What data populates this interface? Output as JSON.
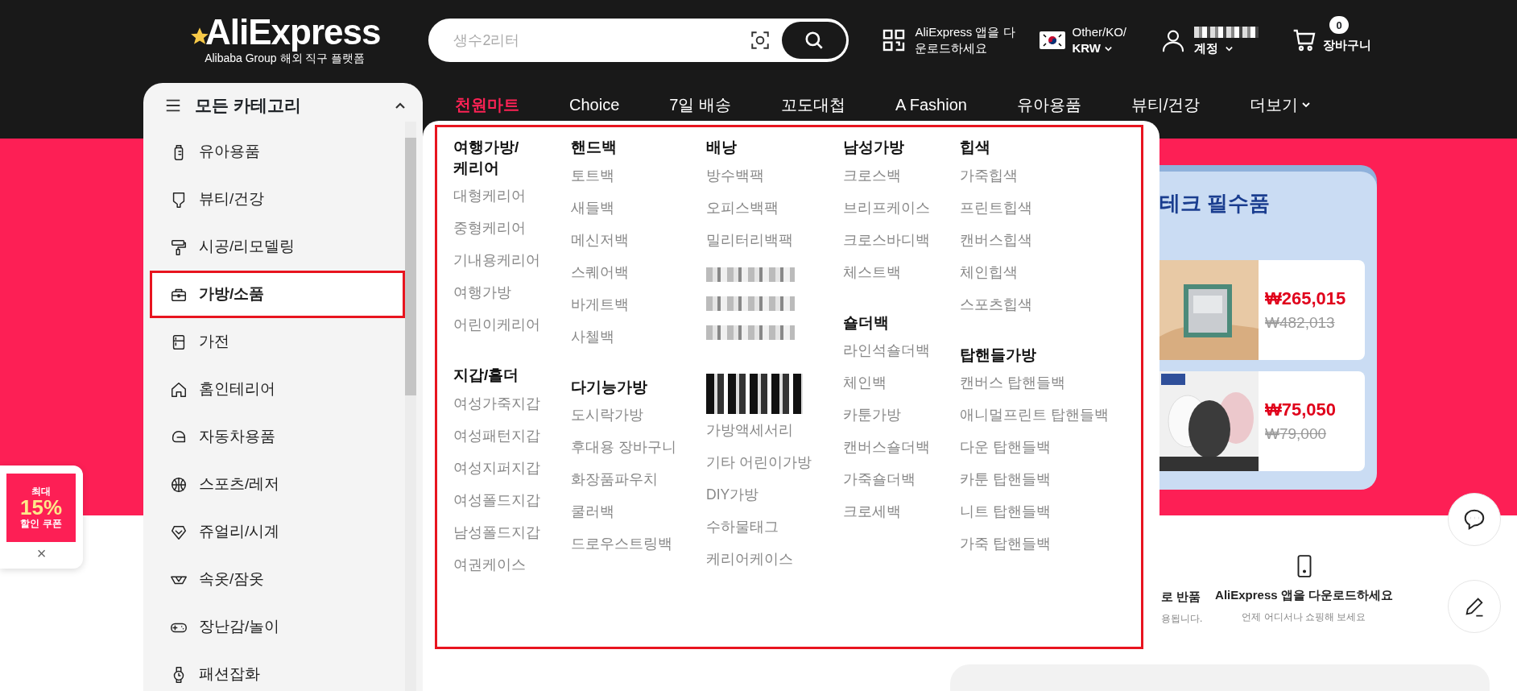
{
  "header": {
    "logo": "AliExpress",
    "tagline": "Alibaba Group 해외 직구 플랫폼",
    "search": {
      "placeholder": "생수2리터"
    },
    "app_download": "AliExpress 앱을 다운로드하세요",
    "region": {
      "line_1": "Other/KO/",
      "line_2": "KRW"
    },
    "account": {
      "name_redacted": true,
      "label": "계정"
    },
    "cart": {
      "count": "0",
      "label": "장바구니"
    }
  },
  "nav": [
    {
      "label": "천원마트",
      "highlight": true
    },
    {
      "label": "Choice",
      "highlight": false
    },
    {
      "label": "7일 배송",
      "highlight": false
    },
    {
      "label": "꼬도대첩",
      "highlight": false
    },
    {
      "label": "A Fashion",
      "highlight": false
    },
    {
      "label": "유아용품",
      "highlight": false
    },
    {
      "label": "뷰티/건강",
      "highlight": false
    },
    {
      "label": "더보기",
      "highlight": false,
      "dropdown": true
    }
  ],
  "sidebar": {
    "title": "모든 카테고리",
    "expanded": true,
    "items": [
      {
        "label": "유아용품",
        "selected": false
      },
      {
        "label": "뷰티/건강",
        "selected": false
      },
      {
        "label": "시공/리모델링",
        "selected": false
      },
      {
        "label": "가방/소품",
        "selected": true
      },
      {
        "label": "가전",
        "selected": false
      },
      {
        "label": "홈인테리어",
        "selected": false
      },
      {
        "label": "자동차용품",
        "selected": false
      },
      {
        "label": "스포츠/레저",
        "selected": false
      },
      {
        "label": "쥬얼리/시계",
        "selected": false
      },
      {
        "label": "속옷/잠옷",
        "selected": false
      },
      {
        "label": "장난감/놀이",
        "selected": false
      },
      {
        "label": "패션잡화",
        "selected": false
      }
    ]
  },
  "mega_menu": {
    "columns": [
      {
        "groups": [
          {
            "heading": {
              "kind": "title",
              "text": "여행가방/케리어"
            },
            "items": [
              {
                "kind": "link",
                "text": "대형케리어"
              },
              {
                "kind": "link",
                "text": "중형케리어"
              },
              {
                "kind": "link",
                "text": "기내용케리어"
              },
              {
                "kind": "link",
                "text": "여행가방"
              },
              {
                "kind": "link",
                "text": "어린이케리어"
              }
            ]
          },
          {
            "heading": {
              "kind": "title",
              "text": "지갑/홀더"
            },
            "items": [
              {
                "kind": "link",
                "text": "여성가죽지갑"
              },
              {
                "kind": "link",
                "text": "여성패턴지갑"
              },
              {
                "kind": "link",
                "text": "여성지퍼지갑"
              },
              {
                "kind": "link",
                "text": "여성폴드지갑"
              },
              {
                "kind": "link",
                "text": "남성폴드지갑"
              },
              {
                "kind": "link",
                "text": "여권케이스"
              }
            ]
          }
        ]
      },
      {
        "groups": [
          {
            "heading": {
              "kind": "title",
              "text": "핸드백"
            },
            "items": [
              {
                "kind": "link",
                "text": "토트백"
              },
              {
                "kind": "link",
                "text": "새들백"
              },
              {
                "kind": "link",
                "text": "메신저백"
              },
              {
                "kind": "link",
                "text": "스퀘어백"
              },
              {
                "kind": "link",
                "text": "바게트백"
              },
              {
                "kind": "link",
                "text": "사첼백"
              }
            ]
          },
          {
            "heading": {
              "kind": "title",
              "text": "다기능가방"
            },
            "items": [
              {
                "kind": "link",
                "text": "도시락가방"
              },
              {
                "kind": "link",
                "text": "후대용 장바구니"
              },
              {
                "kind": "link",
                "text": "화장품파우치"
              },
              {
                "kind": "link",
                "text": "쿨러백"
              },
              {
                "kind": "link",
                "text": "드로우스트링백"
              }
            ]
          }
        ]
      },
      {
        "groups": [
          {
            "heading": {
              "kind": "title",
              "text": "배낭"
            },
            "items": [
              {
                "kind": "link",
                "text": "방수백팩"
              },
              {
                "kind": "link",
                "text": "오피스백팩"
              },
              {
                "kind": "link",
                "text": "밀리터리백팩"
              },
              {
                "kind": "redacted"
              },
              {
                "kind": "redacted"
              },
              {
                "kind": "redacted"
              }
            ]
          },
          {
            "heading": {
              "kind": "redacted"
            },
            "items": [
              {
                "kind": "link",
                "text": "가방액세서리"
              },
              {
                "kind": "link",
                "text": "기타 어린이가방"
              },
              {
                "kind": "link",
                "text": "DIY가방"
              },
              {
                "kind": "link",
                "text": "수하물태그"
              },
              {
                "kind": "link",
                "text": "케리어케이스"
              }
            ]
          }
        ]
      },
      {
        "groups": [
          {
            "heading": {
              "kind": "title",
              "text": "남성가방"
            },
            "items": [
              {
                "kind": "link",
                "text": "크로스백"
              },
              {
                "kind": "link",
                "text": "브리프케이스"
              },
              {
                "kind": "link",
                "text": "크로스바디백"
              },
              {
                "kind": "link",
                "text": "체스트백"
              }
            ]
          },
          {
            "heading": {
              "kind": "title",
              "text": "숄더백"
            },
            "items": [
              {
                "kind": "link",
                "text": "라인석숄더백"
              },
              {
                "kind": "link",
                "text": "체인백"
              },
              {
                "kind": "link",
                "text": "카툰가방"
              },
              {
                "kind": "link",
                "text": "캔버스숄더백"
              },
              {
                "kind": "link",
                "text": "가죽숄더백"
              },
              {
                "kind": "link",
                "text": "크로세백"
              }
            ]
          }
        ]
      },
      {
        "groups": [
          {
            "heading": {
              "kind": "title",
              "text": "힙색"
            },
            "items": [
              {
                "kind": "link",
                "text": "가죽힙색"
              },
              {
                "kind": "link",
                "text": "프린트힙색"
              },
              {
                "kind": "link",
                "text": "캔버스힙색"
              },
              {
                "kind": "link",
                "text": "체인힙색"
              },
              {
                "kind": "link",
                "text": "스포츠힙색"
              }
            ]
          },
          {
            "heading": {
              "kind": "title",
              "text": "탑핸들가방"
            },
            "items": [
              {
                "kind": "link",
                "text": "캔버스 탑핸들백"
              },
              {
                "kind": "link",
                "text": "애니멀프린트 탑핸들백"
              },
              {
                "kind": "link",
                "text": "다운 탑핸들백"
              },
              {
                "kind": "link",
                "text": "카툰 탑핸들백"
              },
              {
                "kind": "link",
                "text": "니트 탑핸들백"
              },
              {
                "kind": "link",
                "text": "가죽 탑핸들백"
              }
            ]
          }
        ]
      }
    ]
  },
  "promo": {
    "title": "테크 필수품",
    "products": [
      {
        "kind": "picture",
        "price": "₩265,015",
        "original_price": "₩482,013"
      },
      {
        "kind": "picture",
        "price": "₩75,050",
        "original_price": "₩79,000"
      }
    ]
  },
  "coupon": {
    "line_1": "최대",
    "line_2": "15%",
    "line_3": "할인 쿠폰",
    "close": "×"
  },
  "features": [
    {
      "title": "로 반품",
      "subtitle": "용됩니다."
    },
    {
      "title": "AliExpress 앱을 다운로드하세요",
      "subtitle": "언제 어디서나 쇼핑해 보세요"
    }
  ]
}
